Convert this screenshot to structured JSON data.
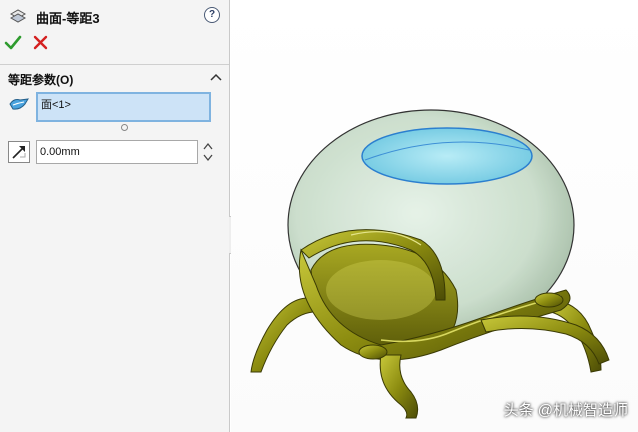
{
  "panel": {
    "title": "曲面-等距3",
    "help_label": "?",
    "ok_icon": "checkmark-icon",
    "cancel_icon": "x-icon",
    "group_title": "等距参数(O)",
    "face_selection": "面<1>",
    "distance_value": "0.00mm"
  },
  "colors": {
    "ok_green": "#2e9b2e",
    "cancel_red": "#d42020",
    "selection_bg": "#cde3f7",
    "selection_border": "#7fb3e0",
    "model_olive": "#8c8c10",
    "highlight_face": "#7fd6ea"
  },
  "watermark": "头条 @机械智造师"
}
